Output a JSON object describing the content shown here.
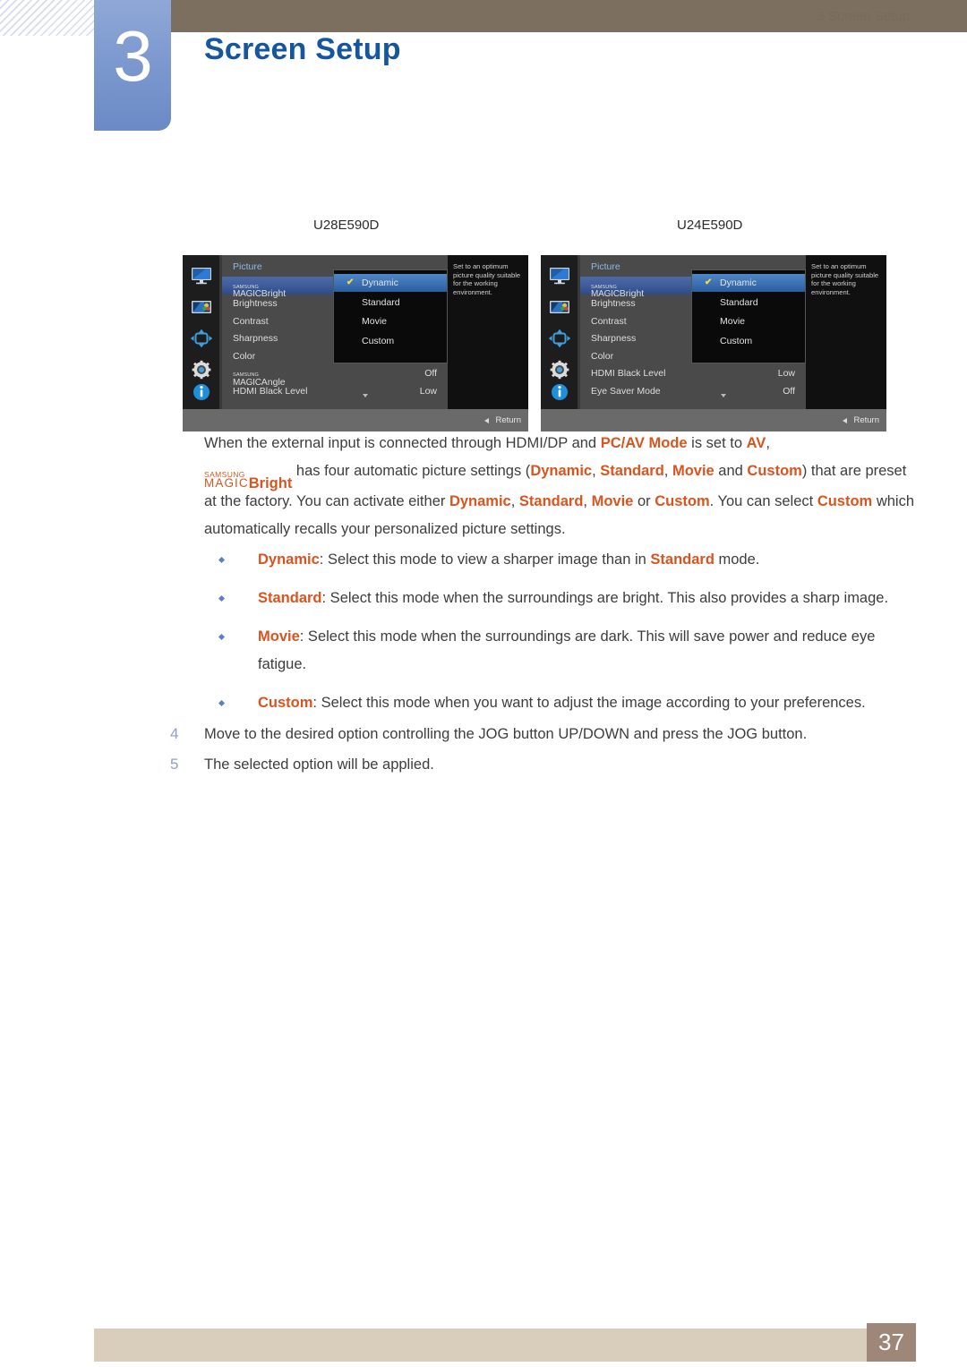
{
  "header": {
    "chapter_number": "3",
    "chapter_title": "Screen Setup"
  },
  "osd_captions": {
    "left": "U28E590D",
    "right": "U24E590D"
  },
  "osd_left": {
    "panel_title": "Picture",
    "rows": [
      {
        "label_prefix_small": "SAMSUNG",
        "label_prefix_big": "MAGIC",
        "label_suffix": "Bright",
        "value": "",
        "selected": true
      },
      {
        "label": "Brightness",
        "value": "",
        "selected": false
      },
      {
        "label": "Contrast",
        "value": "",
        "selected": false
      },
      {
        "label": "Sharpness",
        "value": "",
        "selected": false
      },
      {
        "label": "Color",
        "value": "",
        "selected": false
      },
      {
        "label_prefix_small": "SAMSUNG",
        "label_prefix_big": "MAGIC",
        "label_suffix": "Angle",
        "value": "Off",
        "selected": false
      },
      {
        "label": "HDMI Black Level",
        "value": "Low",
        "selected": false
      }
    ],
    "submenu": [
      {
        "label": "Dynamic",
        "selected": true,
        "check": "✔"
      },
      {
        "label": "Standard",
        "selected": false,
        "check": ""
      },
      {
        "label": "Movie",
        "selected": false,
        "check": ""
      },
      {
        "label": "Custom",
        "selected": false,
        "check": ""
      }
    ],
    "info_text": "Set to an optimum picture quality suitable for the working environment.",
    "return_label": "Return"
  },
  "osd_right": {
    "panel_title": "Picture",
    "rows": [
      {
        "label_prefix_small": "SAMSUNG",
        "label_prefix_big": "MAGIC",
        "label_suffix": "Bright",
        "value": "",
        "selected": true
      },
      {
        "label": "Brightness",
        "value": "",
        "selected": false
      },
      {
        "label": "Contrast",
        "value": "",
        "selected": false
      },
      {
        "label": "Sharpness",
        "value": "",
        "selected": false
      },
      {
        "label": "Color",
        "value": "",
        "selected": false
      },
      {
        "label": "HDMI Black Level",
        "value": "Low",
        "selected": false
      },
      {
        "label": "Eye Saver Mode",
        "value": "Off",
        "selected": false
      }
    ],
    "submenu": [
      {
        "label": "Dynamic",
        "selected": true,
        "check": "✔"
      },
      {
        "label": "Standard",
        "selected": false,
        "check": ""
      },
      {
        "label": "Movie",
        "selected": false,
        "check": ""
      },
      {
        "label": "Custom",
        "selected": false,
        "check": ""
      }
    ],
    "info_text": "Set to an optimum picture quality suitable for the working environment.",
    "return_label": "Return"
  },
  "sidebar_icons": [
    "monitor-icon",
    "picture-icon",
    "navigation-arrows-icon",
    "gear-icon",
    "info-icon"
  ],
  "body": {
    "para_line1_a": "When the external input is connected through HDMI/DP and ",
    "para_line1_hl1": "PC/AV Mode",
    "para_line1_b": " is set to ",
    "para_line1_hl2": "AV",
    "para_line1_c": ",",
    "magic_small": "SAMSUNG",
    "magic_big": "MAGIC",
    "magic_suffix": "Bright",
    "para_line2_a": " has four automatic picture settings (",
    "para_hl_dynamic": "Dynamic",
    "para_sep1": ", ",
    "para_hl_standard": "Standard",
    "para_sep2": ", ",
    "para_hl_movie": "Movie",
    "para_and": " and ",
    "para_hl_custom": "Custom",
    "para_line2_b": ") that are preset at the factory. You can activate either ",
    "para_hl_dynamic2": "Dynamic",
    "para_sep3": ", ",
    "para_hl_standard2": "Standard",
    "para_sep4": ", ",
    "para_hl_movie2": "Movie",
    "para_or": " or ",
    "para_hl_custom2": "Custom",
    "para_line3_b": ". You can select ",
    "para_hl_custom3": "Custom",
    "para_line4": " which automatically recalls your personalized picture settings."
  },
  "bullets": [
    {
      "term": "Dynamic",
      "text_a": ": Select this mode to view a sharper image than in ",
      "term2": "Standard",
      "text_b": " mode."
    },
    {
      "term": "Standard",
      "text_a": ": Select this mode when the surroundings are bright. This also provides a sharp image.",
      "term2": "",
      "text_b": ""
    },
    {
      "term": "Movie",
      "text_a": ": Select this mode when the surroundings are dark. This will save power and reduce eye fatigue.",
      "term2": "",
      "text_b": ""
    },
    {
      "term": "Custom",
      "text_a": ": Select this mode when you want to adjust the image according to your preferences.",
      "term2": "",
      "text_b": ""
    }
  ],
  "steps": [
    {
      "number": "4",
      "text": "Move to the desired option controlling the JOG button UP/DOWN and press the JOG button."
    },
    {
      "number": "5",
      "text": "The selected option will be applied."
    }
  ],
  "footer": {
    "label": "3 Screen Setup",
    "page": "37"
  },
  "colors": {
    "brown_bar": "#7d6f60",
    "chapter_blue": "#7f9bd0",
    "title_blue": "#15569e",
    "highlight_orange": "#d9541f",
    "step_number_blue": "#8a9fd8",
    "footer_beige": "#d9cdbc",
    "page_box_brown": "#9e8678"
  }
}
